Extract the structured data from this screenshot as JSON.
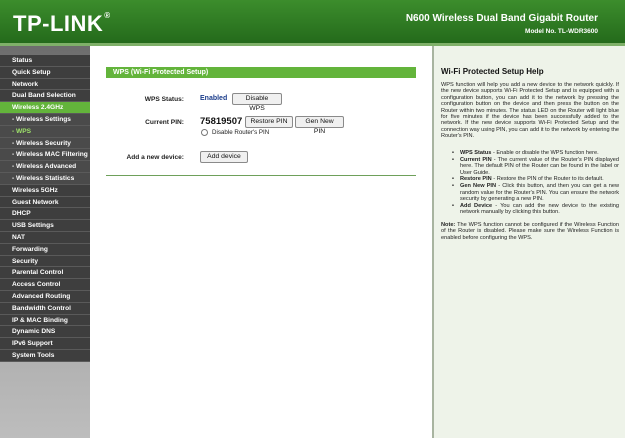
{
  "header": {
    "logo": "TP-LINK",
    "logo_mark": "®",
    "product": "N600 Wireless Dual Band Gigabit Router",
    "model": "Model No. TL-WDR3600"
  },
  "sidebar": {
    "items": [
      {
        "label": "Status",
        "type": "main"
      },
      {
        "label": "Quick Setup",
        "type": "main"
      },
      {
        "label": "Network",
        "type": "main"
      },
      {
        "label": "Dual Band Selection",
        "type": "main"
      },
      {
        "label": "Wireless 2.4GHz",
        "type": "active"
      },
      {
        "label": "- Wireless Settings",
        "type": "sub"
      },
      {
        "label": "- WPS",
        "type": "sub-active"
      },
      {
        "label": "- Wireless Security",
        "type": "sub"
      },
      {
        "label": "- Wireless MAC Filtering",
        "type": "sub"
      },
      {
        "label": "- Wireless Advanced",
        "type": "sub"
      },
      {
        "label": "- Wireless Statistics",
        "type": "sub"
      },
      {
        "label": "Wireless 5GHz",
        "type": "main"
      },
      {
        "label": "Guest Network",
        "type": "main"
      },
      {
        "label": "DHCP",
        "type": "main"
      },
      {
        "label": "USB Settings",
        "type": "main"
      },
      {
        "label": "NAT",
        "type": "main"
      },
      {
        "label": "Forwarding",
        "type": "main"
      },
      {
        "label": "Security",
        "type": "main"
      },
      {
        "label": "Parental Control",
        "type": "main"
      },
      {
        "label": "Access Control",
        "type": "main"
      },
      {
        "label": "Advanced Routing",
        "type": "main"
      },
      {
        "label": "Bandwidth Control",
        "type": "main"
      },
      {
        "label": "IP & MAC Binding",
        "type": "main"
      },
      {
        "label": "Dynamic DNS",
        "type": "main"
      },
      {
        "label": "IPv6 Support",
        "type": "main"
      },
      {
        "label": "System Tools",
        "type": "main"
      }
    ]
  },
  "main": {
    "title": "WPS (Wi-Fi Protected Setup)",
    "wps_status_label": "WPS Status:",
    "wps_status_value": "Enabled",
    "disable_wps_label": "Disable WPS",
    "current_pin_label": "Current PIN:",
    "current_pin_value": "75819507",
    "restore_pin_label": "Restore PIN",
    "gen_new_pin_label": "Gen New PIN",
    "disable_router_pin_label": "Disable Router's PIN",
    "add_new_device_label": "Add a new device:",
    "add_device_label": "Add device"
  },
  "help": {
    "title": "Wi-Fi Protected Setup Help",
    "intro": "WPS function will help you add a new device to the network quickly. If the new device supports Wi-Fi Protected Setup and is equipped with a configuration button, you can add it to the network by pressing the configuration button on the device and then press the button on the Router within two minutes. The status LED on the Router will light blue for five minutes if the device has been successfully added to the network. If the new device supports Wi-Fi Protected Setup and the connection way using PIN, you can add it to the network by entering the Router's PIN.",
    "items": [
      {
        "term": "WPS Status",
        "desc": " - Enable or disable the WPS function here."
      },
      {
        "term": "Current PIN",
        "desc": " - The current value of the Router's PIN displayed here. The default PIN of the Router can be found in the label or User Guide."
      },
      {
        "term": "Restore PIN",
        "desc": " - Restore the PIN of the Router to its default."
      },
      {
        "term": "Gen New PIN",
        "desc": " - Click this button, and then you can get a new random value for the Router's PIN. You can ensure the network security by generating a new PIN."
      },
      {
        "term": "Add Device",
        "desc": " - You can add the new device to the existing network manually by clicking this button."
      }
    ],
    "note_label": "Note:",
    "note": " The WPS function cannot be configured if the Wireless Function of the Router is disabled. Please make sure the Wireless Function is enabled before configuring the WPS."
  },
  "colors": {
    "brand_green": "#2f7a23",
    "accent_green": "#63b43b",
    "status_blue": "#1a3c8b"
  }
}
